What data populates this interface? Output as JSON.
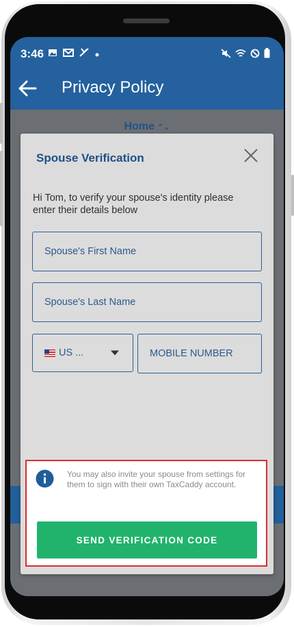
{
  "status_bar": {
    "time": "3:46",
    "left_icons": [
      "image-icon",
      "gmail-icon",
      "missed-call-icon",
      "dot-icon"
    ],
    "right_icons": [
      "mute-icon",
      "wifi-icon",
      "blocked-icon",
      "battery-icon"
    ]
  },
  "header": {
    "title": "Privacy Policy"
  },
  "nav": {
    "home_label": "Home"
  },
  "modal": {
    "title": "Spouse Verification",
    "intro": "Hi Tom, to verify your spouse's identity please enter their details below",
    "first_name_placeholder": "Spouse's First Name",
    "last_name_placeholder": "Spouse's Last Name",
    "country_code": "US ...",
    "mobile_placeholder": "MOBILE NUMBER",
    "notice": "You may also invite your spouse from settings for them to sign with their own TaxCaddy account.",
    "send_button": "SEND VERIFICATION CODE"
  },
  "colors": {
    "primary": "#24619e",
    "accent_text": "#1f4f87",
    "button": "#21b36c",
    "highlight_border": "#d92e2e"
  }
}
